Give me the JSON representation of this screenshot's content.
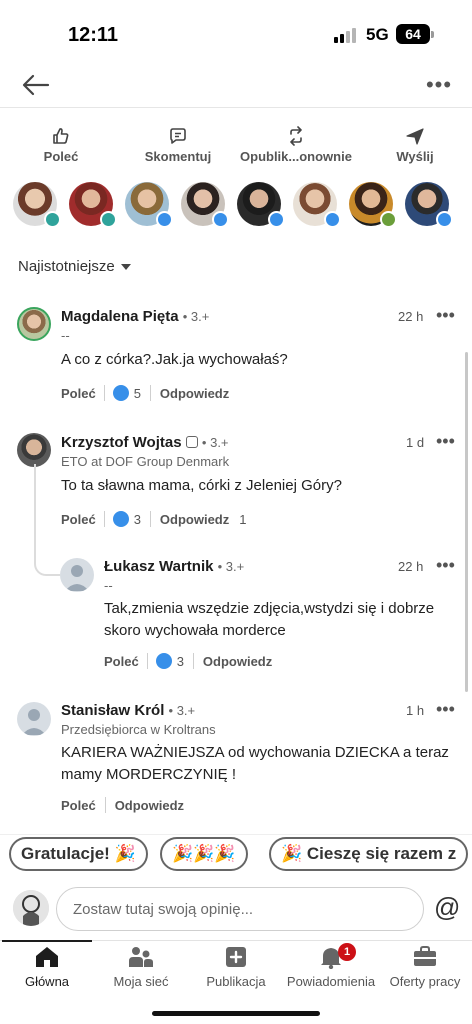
{
  "status_bar": {
    "time": "12:11",
    "network": "5G",
    "battery": "64"
  },
  "actions": [
    {
      "label": "Poleć",
      "icon": "thumbs-up-icon"
    },
    {
      "label": "Skomentuj",
      "icon": "comment-icon"
    },
    {
      "label": "Opublik...onownie",
      "icon": "repost-icon"
    },
    {
      "label": "Wyślij",
      "icon": "send-icon"
    }
  ],
  "sort_label": "Najistotniejsze",
  "comments": [
    {
      "name": "Magdalena Pięta",
      "degree": "• 3.+",
      "subtitle": "--",
      "time": "22 h",
      "text": "A co z córka?.Jak.ja wychowałaś?",
      "like_label": "Poleć",
      "likes": "5",
      "reply_label": "Odpowiedz"
    },
    {
      "name": "Krzysztof Wojtas",
      "degree": "• 3.+",
      "subtitle": "ETO at DOF Group Denmark",
      "time": "1 d",
      "text": "To ta sławna mama, córki z Jeleniej Góry?",
      "like_label": "Poleć",
      "likes": "3",
      "reply_label": "Odpowiedz",
      "replies": "1"
    },
    {
      "name": "Łukasz Wartnik",
      "degree": "• 3.+",
      "subtitle": "--",
      "time": "22 h",
      "text": "Tak,zmienia wszędzie zdjęcia,wstydzi się i dobrze skoro wychowała morderce",
      "like_label": "Poleć",
      "likes": "3",
      "reply_label": "Odpowiedz"
    },
    {
      "name": "Stanisław Król",
      "degree": "• 3.+",
      "subtitle": "Przedsiębiorca w Kroltrans",
      "time": "1 h",
      "text": "KARIERA WAŻNIEJSZA od wychowania DZIECKA a teraz mamy MORDERCZYNIĘ !",
      "like_label": "Poleć",
      "reply_label": "Odpowiedz"
    }
  ],
  "quick_replies": [
    "Gratulacje! 🎉",
    "🎉🎉🎉",
    "🎉 Cieszę się razem z"
  ],
  "compose": {
    "placeholder": "Zostaw tutaj swoją opinię..."
  },
  "tabs": [
    {
      "label": "Główna",
      "icon": "home-icon"
    },
    {
      "label": "Moja sieć",
      "icon": "network-icon"
    },
    {
      "label": "Publikacja",
      "icon": "post-icon"
    },
    {
      "label": "Powiadomienia",
      "icon": "bell-icon",
      "badge": "1"
    },
    {
      "label": "Oferty pracy",
      "icon": "briefcase-icon"
    }
  ],
  "colors": {
    "accent": "#378fe9",
    "badge": "#cc1016",
    "text": "#1d1d1d",
    "muted": "#666666"
  }
}
